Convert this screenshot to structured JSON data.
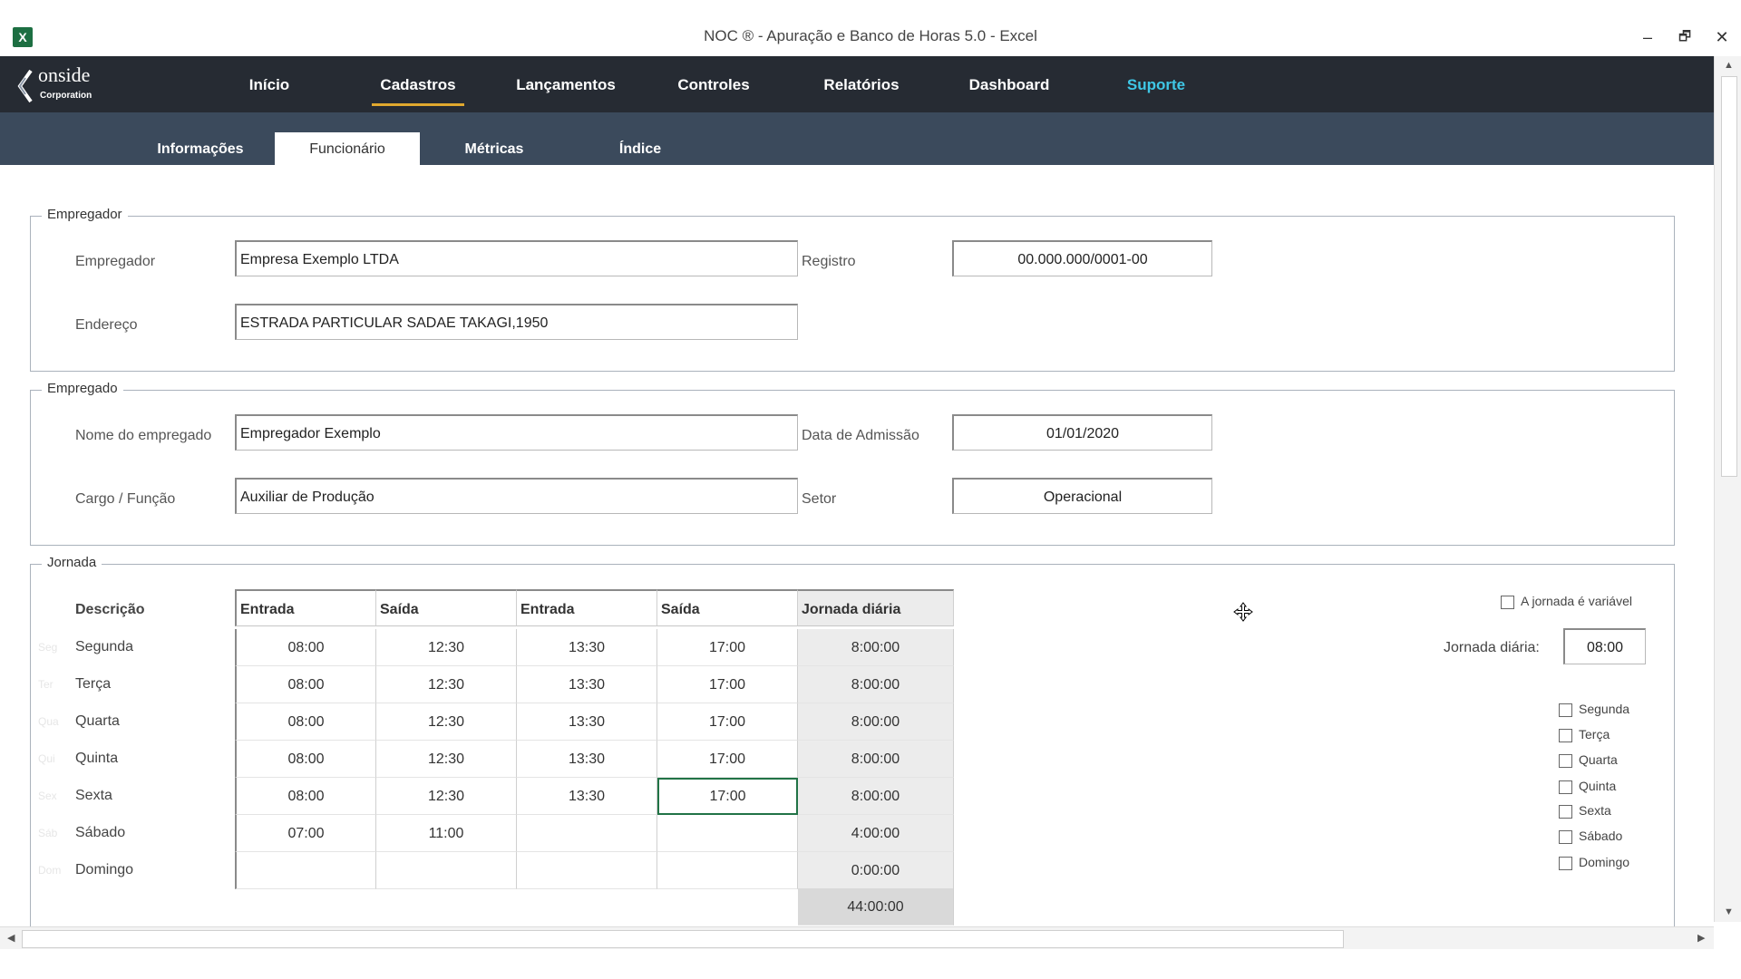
{
  "window": {
    "title": "NOC ® - Apuração e Banco de Horas 5.0 - Excel",
    "app_icon": "excel-icon",
    "minimize": "–",
    "restore": "🗗",
    "close": "✕"
  },
  "logo": {
    "brand": "onside",
    "sub": "Corporation"
  },
  "nav": {
    "items": [
      "Início",
      "Cadastros",
      "Lançamentos",
      "Controles",
      "Relatórios",
      "Dashboard",
      "Suporte"
    ],
    "active": "Cadastros",
    "accent": "#e0a82e",
    "support_color": "#3fc7e6"
  },
  "subnav": {
    "tabs": [
      "Informações",
      "Funcionário",
      "Métricas",
      "Índice"
    ],
    "active": "Funcionário"
  },
  "empregador": {
    "group_title": "Empregador",
    "empregador_label": "Empregador",
    "empregador_value": "Empresa Exemplo LTDA",
    "registro_label": "Registro",
    "registro_value": "00.000.000/0001-00",
    "endereco_label": "Endereço",
    "endereco_value": "ESTRADA PARTICULAR SADAE TAKAGI,1950"
  },
  "empregado": {
    "group_title": "Empregado",
    "nome_label": "Nome do empregado",
    "nome_value": "Empregador Exemplo",
    "admissao_label": "Data de Admissão",
    "admissao_value": "01/01/2020",
    "cargo_label": "Cargo / Função",
    "cargo_value": "Auxiliar de Produção",
    "setor_label": "Setor",
    "setor_value": "Operacional"
  },
  "jornada": {
    "group_title": "Jornada",
    "descricao_label": "Descrição",
    "columns": [
      "Entrada",
      "Saída",
      "Entrada",
      "Saída",
      "Jornada diária"
    ],
    "rows": [
      {
        "ghost": "Seg",
        "day": "Segunda",
        "cells": [
          "08:00",
          "12:30",
          "13:30",
          "17:00",
          "8:00:00"
        ]
      },
      {
        "ghost": "Ter",
        "day": "Terça",
        "cells": [
          "08:00",
          "12:30",
          "13:30",
          "17:00",
          "8:00:00"
        ]
      },
      {
        "ghost": "Qua",
        "day": "Quarta",
        "cells": [
          "08:00",
          "12:30",
          "13:30",
          "17:00",
          "8:00:00"
        ]
      },
      {
        "ghost": "Qui",
        "day": "Quinta",
        "cells": [
          "08:00",
          "12:30",
          "13:30",
          "17:00",
          "8:00:00"
        ]
      },
      {
        "ghost": "Sex",
        "day": "Sexta",
        "cells": [
          "08:00",
          "12:30",
          "13:30",
          "17:00",
          "8:00:00"
        ]
      },
      {
        "ghost": "Sáb",
        "day": "Sábado",
        "cells": [
          "07:00",
          "11:00",
          "",
          "",
          "4:00:00"
        ]
      },
      {
        "ghost": "Dom",
        "day": "Domingo",
        "cells": [
          "",
          "",
          "",
          "",
          "0:00:00"
        ]
      }
    ],
    "total": "44:00:00",
    "variable_label": "A jornada é variável",
    "daily_label": "Jornada diária:",
    "daily_value": "08:00",
    "weekday_checks": [
      "Segunda",
      "Terça",
      "Quarta",
      "Quinta",
      "Sexta",
      "Sábado",
      "Domingo"
    ],
    "selected_cell_color": "#217346"
  }
}
